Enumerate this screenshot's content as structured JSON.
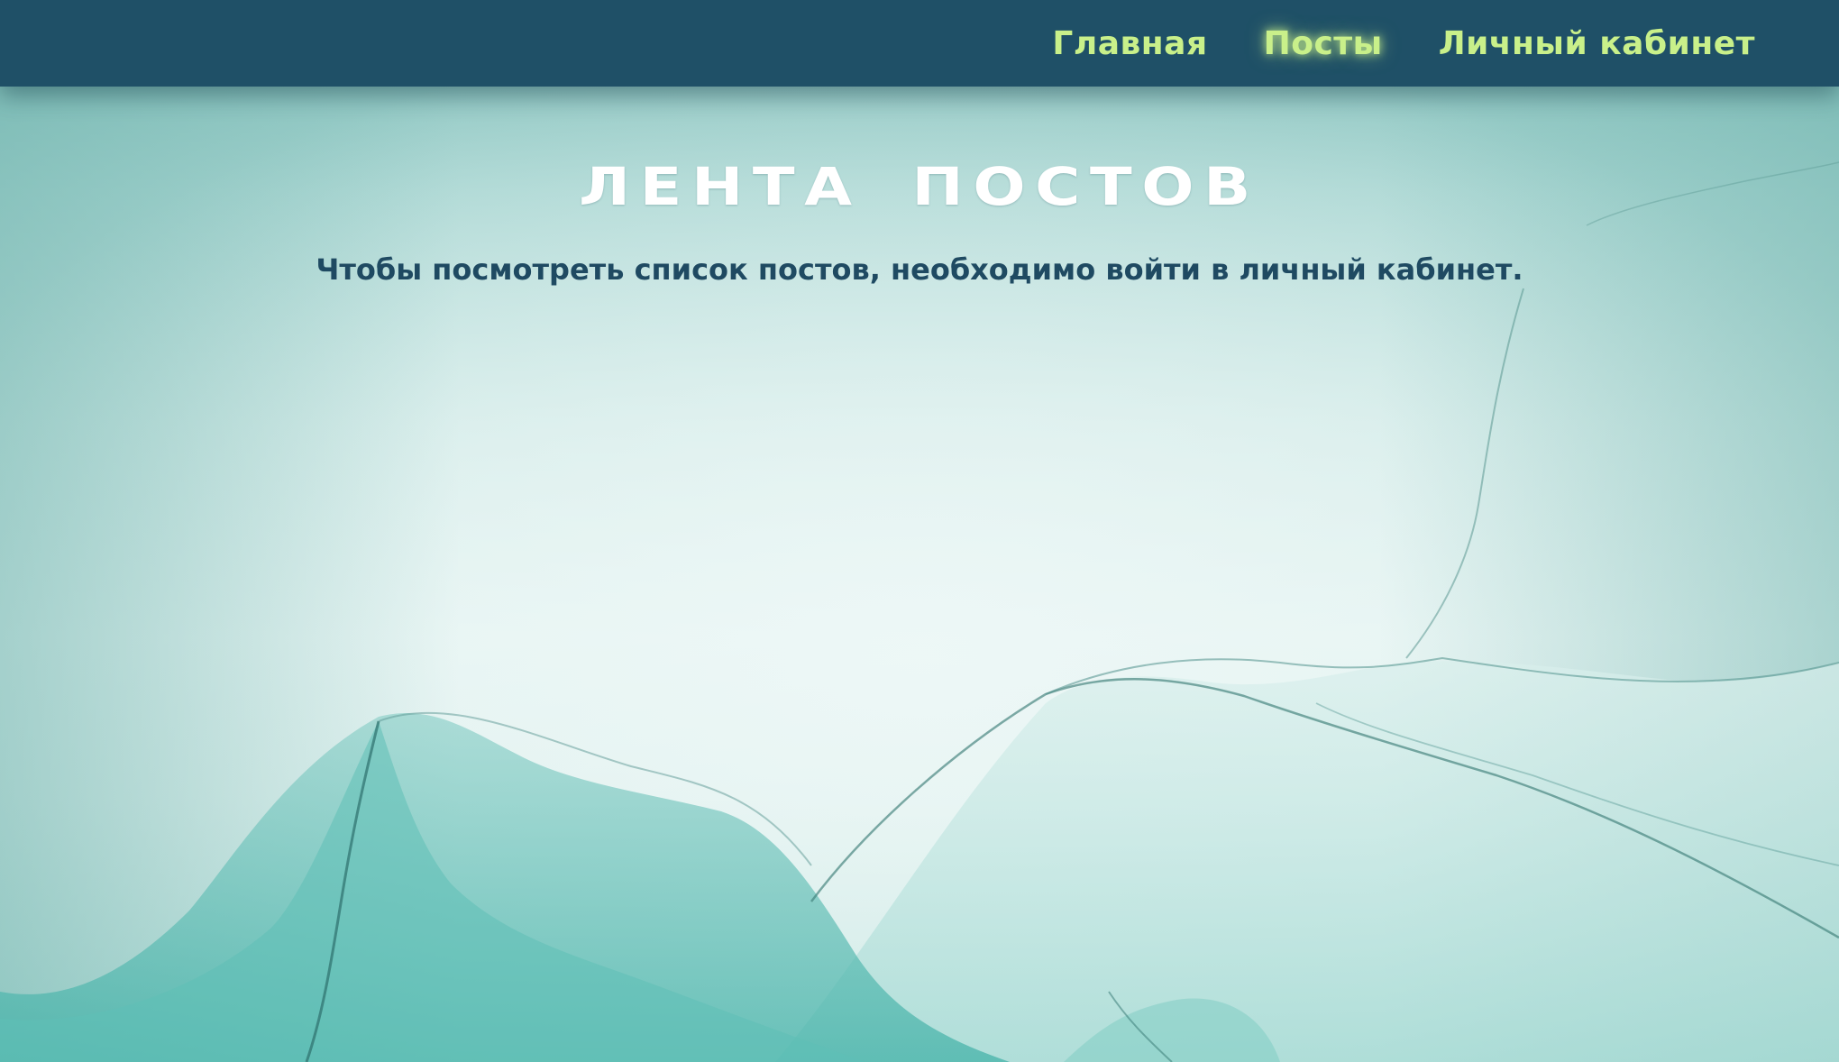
{
  "nav": {
    "items": [
      {
        "label": "Главная"
      },
      {
        "label": "Посты"
      },
      {
        "label": "Личный кабинет"
      }
    ],
    "active": "Посты"
  },
  "main": {
    "title": "ЛЕНТА ПОСТОВ",
    "message": "Чтобы посмотреть список постов, необходимо войти в личный кабинет."
  },
  "colors": {
    "navbar": "#1f5067",
    "nav_link": "#c9f08a",
    "title": "#ffffff",
    "message": "#1f4a62"
  }
}
